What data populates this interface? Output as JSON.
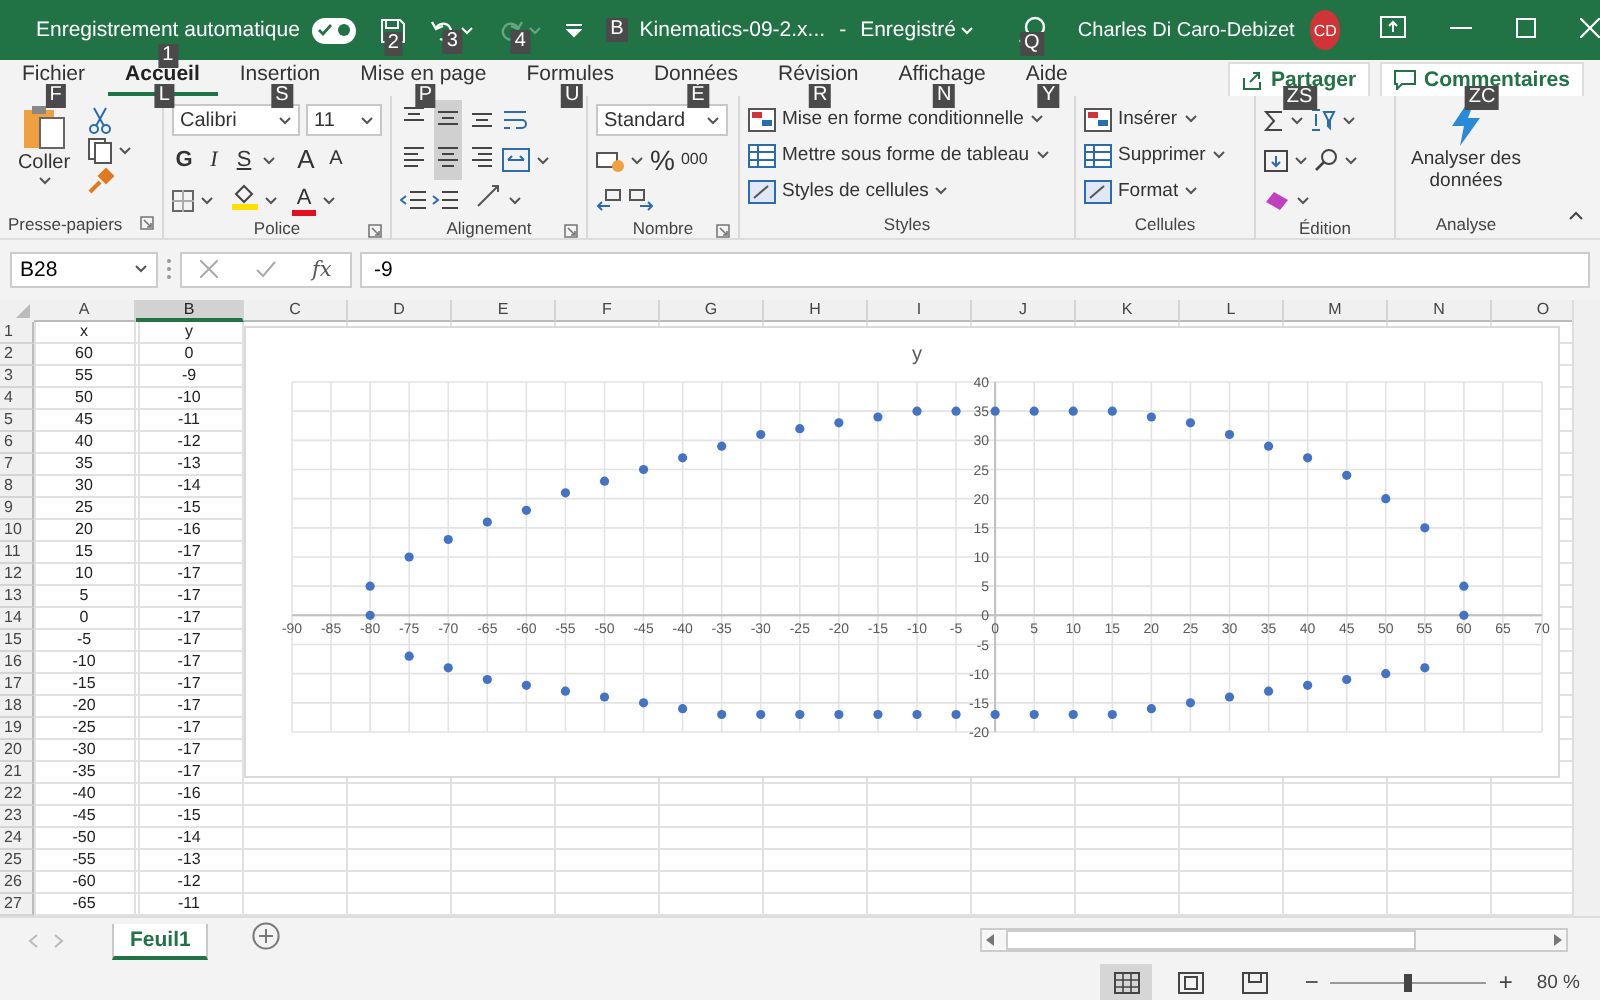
{
  "title_bar": {
    "autosave": {
      "label": "Enregistrement automatique",
      "on": true,
      "keytip": "1"
    },
    "save_keytip": "2",
    "undo_keytip": "3",
    "redo": {
      "disabled": true,
      "keytip": "4"
    },
    "file": {
      "keytip": "B",
      "name": "Kinematics-09-2.x...",
      "separator": "-",
      "status": "Enregistré"
    },
    "search_keytip": "Q",
    "user": {
      "name": "Charles Di Caro-Debizet",
      "initials": "CD"
    }
  },
  "tabs": [
    {
      "label": "Fichier",
      "selected": false,
      "keytip": "F"
    },
    {
      "label": "Accueil",
      "selected": true,
      "keytip": "L"
    },
    {
      "label": "Insertion",
      "selected": false,
      "keytip": "S"
    },
    {
      "label": "Mise en page",
      "selected": false,
      "keytip": "P"
    },
    {
      "label": "Formules",
      "selected": false,
      "keytip": "U"
    },
    {
      "label": "Données",
      "selected": false,
      "keytip": "É"
    },
    {
      "label": "Révision",
      "selected": false,
      "keytip": "R"
    },
    {
      "label": "Affichage",
      "selected": false,
      "keytip": "N"
    },
    {
      "label": "Aide",
      "selected": false,
      "keytip": "Y"
    }
  ],
  "share": {
    "label": "Partager",
    "keytip": "ZS"
  },
  "comments": {
    "label": "Commentaires",
    "keytip": "ZC"
  },
  "ribbon": {
    "clipboard": {
      "label": "Presse-papiers",
      "paste": "Coller"
    },
    "font": {
      "label": "Police",
      "font_name": "Calibri",
      "font_size": "11",
      "bold": "G",
      "italic": "I",
      "underline": "S",
      "grow": "A",
      "shrink": "A",
      "font_color": "A"
    },
    "alignment": {
      "label": "Alignement",
      "vertical": [
        {
          "selected": false
        },
        {
          "selected": true
        },
        {
          "selected": false
        }
      ],
      "horizontal": [
        {
          "selected": false
        },
        {
          "selected": true
        },
        {
          "selected": false
        }
      ]
    },
    "number": {
      "label": "Nombre",
      "format": "Standard",
      "percent": "%",
      "thousands": "000"
    },
    "styles": {
      "label": "Styles",
      "items": [
        "Mise en forme conditionnelle",
        "Mettre sous forme de tableau",
        "Styles de cellules"
      ]
    },
    "cells": {
      "label": "Cellules",
      "items": [
        "Insérer",
        "Supprimer",
        "Format"
      ]
    },
    "editing": {
      "label": "Édition"
    },
    "analysis": {
      "label": "Analyse",
      "button": "Analyser des données"
    }
  },
  "formula_bar": {
    "name_box": "B28",
    "fx": "fx",
    "formula": "-9"
  },
  "sheet": {
    "columns": [
      {
        "label": "A",
        "selected": false
      },
      {
        "label": "B",
        "selected": true
      },
      {
        "label": "C",
        "selected": false
      },
      {
        "label": "D",
        "selected": false
      },
      {
        "label": "E",
        "selected": false
      },
      {
        "label": "F",
        "selected": false
      },
      {
        "label": "G",
        "selected": false
      },
      {
        "label": "H",
        "selected": false
      },
      {
        "label": "I",
        "selected": false
      },
      {
        "label": "J",
        "selected": false
      },
      {
        "label": "K",
        "selected": false
      },
      {
        "label": "L",
        "selected": false
      },
      {
        "label": "M",
        "selected": false
      },
      {
        "label": "N",
        "selected": false
      },
      {
        "label": "O",
        "selected": false
      }
    ],
    "rows": [
      {
        "number": "1",
        "cells": [
          "x",
          "y"
        ]
      },
      {
        "number": "2",
        "cells": [
          "60",
          "0"
        ]
      },
      {
        "number": "3",
        "cells": [
          "55",
          "-9"
        ]
      },
      {
        "number": "4",
        "cells": [
          "50",
          "-10"
        ]
      },
      {
        "number": "5",
        "cells": [
          "45",
          "-11"
        ]
      },
      {
        "number": "6",
        "cells": [
          "40",
          "-12"
        ]
      },
      {
        "number": "7",
        "cells": [
          "35",
          "-13"
        ]
      },
      {
        "number": "8",
        "cells": [
          "30",
          "-14"
        ]
      },
      {
        "number": "9",
        "cells": [
          "25",
          "-15"
        ]
      },
      {
        "number": "10",
        "cells": [
          "20",
          "-16"
        ]
      },
      {
        "number": "11",
        "cells": [
          "15",
          "-17"
        ]
      },
      {
        "number": "12",
        "cells": [
          "10",
          "-17"
        ]
      },
      {
        "number": "13",
        "cells": [
          "5",
          "-17"
        ]
      },
      {
        "number": "14",
        "cells": [
          "0",
          "-17"
        ]
      },
      {
        "number": "15",
        "cells": [
          "-5",
          "-17"
        ]
      },
      {
        "number": "16",
        "cells": [
          "-10",
          "-17"
        ]
      },
      {
        "number": "17",
        "cells": [
          "-15",
          "-17"
        ]
      },
      {
        "number": "18",
        "cells": [
          "-20",
          "-17"
        ]
      },
      {
        "number": "19",
        "cells": [
          "-25",
          "-17"
        ]
      },
      {
        "number": "20",
        "cells": [
          "-30",
          "-17"
        ]
      },
      {
        "number": "21",
        "cells": [
          "-35",
          "-17"
        ]
      },
      {
        "number": "22",
        "cells": [
          "-40",
          "-16"
        ]
      },
      {
        "number": "23",
        "cells": [
          "-45",
          "-15"
        ]
      },
      {
        "number": "24",
        "cells": [
          "-50",
          "-14"
        ]
      },
      {
        "number": "25",
        "cells": [
          "-55",
          "-13"
        ]
      },
      {
        "number": "26",
        "cells": [
          "-60",
          "-12"
        ]
      },
      {
        "number": "27",
        "cells": [
          "-65",
          "-11"
        ]
      }
    ]
  },
  "chart": {
    "chart_data": {
      "type": "scatter",
      "title": "y",
      "x": [
        60,
        55,
        50,
        45,
        40,
        35,
        30,
        25,
        20,
        15,
        10,
        5,
        0,
        -5,
        -10,
        -15,
        -20,
        -25,
        -30,
        -35,
        -40,
        -45,
        -50,
        -55,
        -60,
        -65,
        -70,
        -75,
        -80,
        -80,
        -75,
        -70,
        -65,
        -60,
        -55,
        -50,
        -45,
        -40,
        -35,
        -30,
        -25,
        -20,
        -15,
        -10,
        -5,
        0,
        5,
        10,
        15,
        20,
        25,
        30,
        35,
        40,
        45,
        50,
        55,
        60
      ],
      "series": [
        {
          "color": "#4472c4",
          "values": [
            0,
            -9,
            -10,
            -11,
            -12,
            -13,
            -14,
            -15,
            -16,
            -17,
            -17,
            -17,
            -17,
            -17,
            -17,
            -17,
            -17,
            -17,
            -17,
            -17,
            -16,
            -15,
            -14,
            -13,
            -12,
            -11,
            -9,
            -7,
            0,
            5,
            10,
            13,
            16,
            18,
            21,
            23,
            25,
            27,
            29,
            31,
            32,
            33,
            34,
            35,
            35,
            35,
            35,
            35,
            35,
            34,
            33,
            31,
            29,
            27,
            24,
            20,
            15,
            5
          ]
        }
      ],
      "xlim": [
        -90,
        70
      ],
      "ylim": [
        -20,
        40
      ],
      "xticks": [
        -90,
        -85,
        -80,
        -75,
        -70,
        -65,
        -60,
        -55,
        -50,
        -45,
        -40,
        -35,
        -30,
        -25,
        -20,
        -15,
        -10,
        -5,
        0,
        5,
        10,
        15,
        20,
        25,
        30,
        35,
        40,
        45,
        50,
        55,
        60,
        65,
        70
      ],
      "yticks": [
        -20,
        -15,
        -10,
        -5,
        0,
        5,
        10,
        15,
        20,
        25,
        30,
        35,
        40
      ],
      "grid": true
    }
  },
  "sheet_tabs": [
    {
      "label": "Feuil1",
      "selected": true
    }
  ],
  "status_bar": {
    "views": [
      {
        "selected": true
      },
      {
        "selected": false
      },
      {
        "selected": false
      }
    ],
    "zoom": {
      "out": "−",
      "in": "+",
      "level": 0.5,
      "label": "80 %"
    }
  }
}
